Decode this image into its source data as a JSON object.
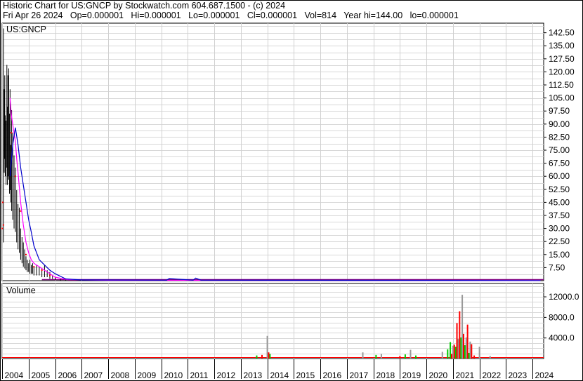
{
  "header": {
    "line1": "Historic Chart for US:GNCP by Stockwatch.com 604.687.1500 - (c) 2024",
    "line2": "Fri Apr 26 2024   Op=0.000001   Hi=0.000001   Lo=0.000001   Cl=0.000001   Vol=814   Year hi=144.00   lo=0.000001"
  },
  "chart_data": [
    {
      "type": "line",
      "title": "US:GNCP",
      "ylim": [
        0,
        148
      ],
      "y_ticks": [
        "142.50",
        "135.00",
        "127.50",
        "120.00",
        "112.50",
        "105.00",
        "97.50",
        "90.00",
        "82.50",
        "75.00",
        "67.50",
        "60.00",
        "52.50",
        "45.00",
        "37.50",
        "30.00",
        "22.50",
        "15.00",
        "7.50"
      ],
      "y_tick_values": [
        142.5,
        135,
        127.5,
        120,
        112.5,
        105,
        97.5,
        90,
        82.5,
        75,
        67.5,
        60,
        52.5,
        45,
        37.5,
        30,
        22.5,
        15,
        7.5
      ],
      "x_ticks": [
        "2004",
        "2005",
        "2006",
        "2007",
        "2008",
        "2009",
        "2010",
        "2011",
        "2012",
        "2013",
        "2014",
        "2015",
        "2016",
        "2017",
        "2018",
        "2019",
        "2020",
        "2021",
        "2022",
        "2023",
        "2024"
      ],
      "grid": true,
      "series": [
        {
          "type": "hlc",
          "color": "#000000",
          "x": [
            2004.05,
            2004.08,
            2004.1,
            2004.12,
            2004.15,
            2004.18,
            2004.2,
            2004.22,
            2004.25,
            2004.28,
            2004.3,
            2004.33,
            2004.36,
            2004.4,
            2004.45,
            2004.5,
            2004.55,
            2004.6,
            2004.65,
            2004.7,
            2004.75,
            2004.8,
            2004.85,
            2004.9,
            2004.95,
            2005.0,
            2005.05,
            2005.1,
            2005.15,
            2005.2,
            2005.3,
            2005.4,
            2005.5,
            2005.6,
            2005.7,
            2005.8,
            2005.9,
            2006.0,
            2006.2,
            2006.4
          ],
          "high": [
            145,
            110,
            118,
            95,
            92,
            124,
            100,
            118,
            122,
            96,
            110,
            78,
            98,
            85,
            72,
            65,
            52,
            44,
            42,
            30,
            25,
            22,
            18,
            14,
            12,
            10,
            12,
            9,
            10,
            8,
            9,
            8,
            7,
            9,
            6,
            5,
            3,
            2,
            1,
            0.5
          ],
          "low": [
            22,
            62,
            70,
            60,
            55,
            65,
            55,
            60,
            58,
            50,
            52,
            45,
            40,
            35,
            30,
            28,
            22,
            18,
            16,
            12,
            10,
            8,
            7,
            6,
            5,
            5,
            4,
            4,
            4,
            3,
            3,
            3,
            2,
            2,
            2,
            1,
            1,
            0.5,
            0.2,
            0.1
          ]
        },
        {
          "type": "points",
          "color": "#ff0000",
          "x": [
            2004.0,
            2004.02,
            2004.05,
            2004.35,
            2004.5,
            2004.7,
            2004.9,
            2005.2,
            2005.5,
            2005.8
          ],
          "y": [
            30,
            45,
            32,
            85,
            60,
            40,
            15,
            8,
            6,
            3
          ]
        },
        {
          "name": "",
          "color": "#ff00ff",
          "x": [
            2004.3,
            2004.35,
            2004.4,
            2004.45,
            2004.5,
            2004.55,
            2004.6,
            2004.7,
            2004.8,
            2004.9,
            2005.0,
            2005.1,
            2005.2,
            2005.3,
            2005.5,
            2005.7,
            2006.0,
            2006.5,
            2008.0,
            2024.3
          ],
          "y": [
            105,
            95,
            90,
            85,
            80,
            70,
            62,
            45,
            32,
            22,
            16,
            12,
            10,
            9,
            7,
            5,
            2,
            0.5,
            0.2,
            0.1
          ]
        },
        {
          "name": "",
          "color": "#0000cc",
          "x": [
            2004.3,
            2004.4,
            2004.5,
            2004.6,
            2004.7,
            2004.8,
            2004.9,
            2005.0,
            2005.1,
            2005.2,
            2005.4,
            2005.6,
            2005.8,
            2006.0,
            2006.4,
            2007.0,
            2010.2,
            2010.3,
            2011.2,
            2011.3,
            2011.5,
            2024.3
          ],
          "y": [
            60,
            78,
            88,
            78,
            65,
            55,
            45,
            35,
            28,
            20,
            12,
            9,
            6,
            4,
            1,
            0.4,
            0.3,
            1.2,
            0.3,
            1.5,
            0.3,
            0.1
          ]
        }
      ]
    },
    {
      "type": "bar",
      "title": "Volume",
      "ylim": [
        0,
        14600
      ],
      "y_ticks": [
        "12000.0",
        "8000.0",
        "4000.0"
      ],
      "y_tick_values": [
        12000,
        8000,
        4000
      ],
      "grid": true,
      "series": [
        {
          "name": "",
          "color": "#999999",
          "x": [
            2014.0,
            2017.6,
            2018.3,
            2019.4,
            2020.6,
            2021.0,
            2021.2,
            2021.35,
            2021.5,
            2021.65,
            2022.0,
            2022.4
          ],
          "values": [
            4400,
            1200,
            900,
            1700,
            1300,
            2500,
            3800,
            12400,
            4100,
            3300,
            2300,
            500
          ]
        },
        {
          "name": "",
          "color": "#00cc00",
          "x": [
            2013.6,
            2014.1,
            2018.1,
            2019.2,
            2019.6,
            2020.8,
            2020.9,
            2021.1,
            2021.3,
            2021.45,
            2021.6
          ],
          "values": [
            600,
            900,
            700,
            800,
            600,
            1800,
            3200,
            2300,
            4100,
            2600,
            1100
          ]
        },
        {
          "name": "",
          "color": "#ff0000",
          "x": [
            2013.8,
            2014.05,
            2019.0,
            2020.95,
            2021.05,
            2021.15,
            2021.25,
            2021.4,
            2021.55,
            2021.7,
            2021.8
          ],
          "values": [
            700,
            1200,
            500,
            900,
            2700,
            6900,
            9200,
            4800,
            6600,
            2800,
            600
          ]
        }
      ]
    }
  ]
}
